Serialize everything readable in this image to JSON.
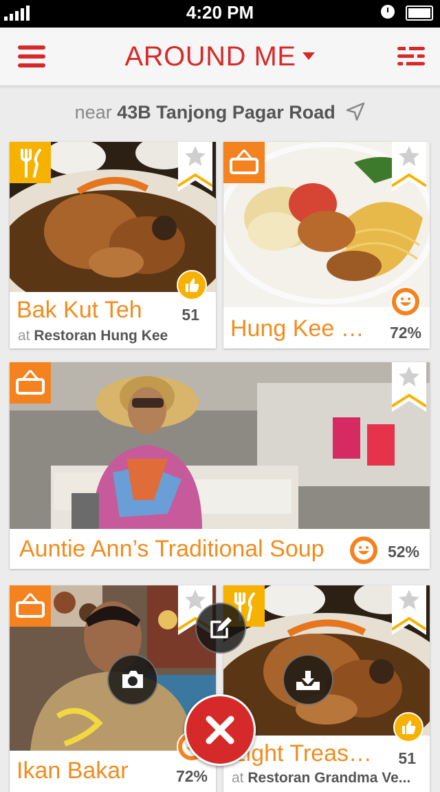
{
  "status_bar": {
    "time": "4:20 PM"
  },
  "nav": {
    "title": "AROUND ME",
    "menu_icon": "hamburger-icon",
    "filter_icon": "filter-list-icon"
  },
  "location": {
    "prefix": "near",
    "address": "43B Tanjong Pagar Road",
    "icon": "location-arrow-icon"
  },
  "cards": [
    {
      "name": "Bak Kut Teh",
      "subtitle_prefix": "at",
      "venue": "Restoran Hung Kee",
      "metric": "51",
      "category": "food",
      "rating": "like"
    },
    {
      "name": "Hung Kee Wa...",
      "metric": "72%",
      "category": "shop",
      "rating": "happy"
    },
    {
      "name": "Auntie Ann’s Traditional Soup",
      "metric": "52%",
      "category": "shop",
      "rating": "happy"
    },
    {
      "name": "Ikan Bakar",
      "metric": "72%",
      "category": "shop",
      "rating": "happy"
    },
    {
      "name": "Eight Treasures",
      "subtitle_prefix": "at",
      "venue": "Restoran Grandma Ve...",
      "metric": "51",
      "category": "food",
      "rating": "like"
    }
  ],
  "actions": [
    {
      "name": "compose",
      "icon": "edit-icon"
    },
    {
      "name": "camera",
      "icon": "camera-icon"
    },
    {
      "name": "check-in",
      "icon": "tray-icon"
    },
    {
      "name": "close",
      "icon": "close-icon"
    }
  ],
  "colors": {
    "accent": "#d62a2a",
    "orange": "#f08c1e",
    "food_badge": "#f7b200",
    "shop_badge": "#f4821f"
  }
}
